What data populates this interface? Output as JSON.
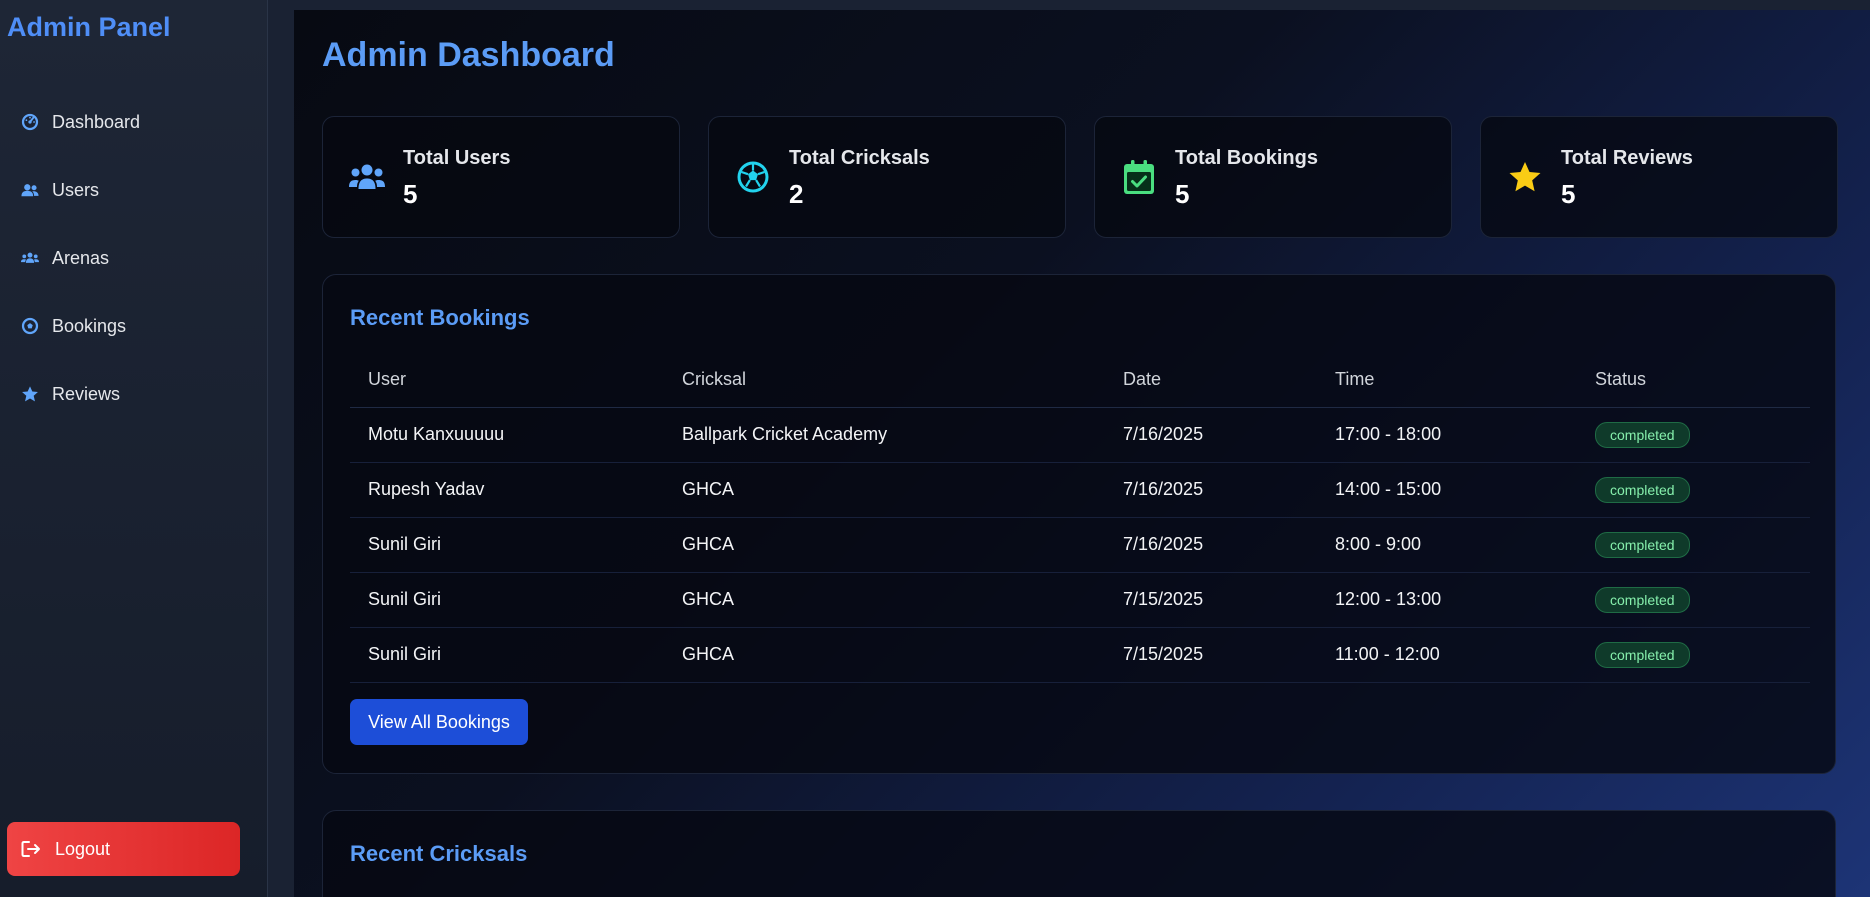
{
  "sidebar": {
    "brand": "Admin Panel",
    "items": [
      {
        "label": "Dashboard",
        "icon": "tachometer-icon"
      },
      {
        "label": "Users",
        "icon": "users-icon"
      },
      {
        "label": "Arenas",
        "icon": "users-group-icon"
      },
      {
        "label": "Bookings",
        "icon": "futbol-icon"
      },
      {
        "label": "Reviews",
        "icon": "star-icon"
      }
    ],
    "logout_label": "Logout"
  },
  "main": {
    "title": "Admin Dashboard",
    "stats": [
      {
        "label": "Total Users",
        "value": "5",
        "icon": "users-icon",
        "color": "#60a5fa"
      },
      {
        "label": "Total Cricksals",
        "value": "2",
        "icon": "futbol-icon",
        "color": "#22d3ee"
      },
      {
        "label": "Total Bookings",
        "value": "5",
        "icon": "calendar-check-icon",
        "color": "#4ade80"
      },
      {
        "label": "Total Reviews",
        "value": "5",
        "icon": "star-icon",
        "color": "#facc15"
      }
    ],
    "recent_bookings": {
      "title": "Recent Bookings",
      "columns": [
        "User",
        "Cricksal",
        "Date",
        "Time",
        "Status"
      ],
      "rows": [
        {
          "user": "Motu Kanxuuuuu",
          "cricksal": "Ballpark Cricket Academy",
          "date": "7/16/2025",
          "time": "17:00 - 18:00",
          "status": "completed"
        },
        {
          "user": "Rupesh Yadav",
          "cricksal": "GHCA",
          "date": "7/16/2025",
          "time": "14:00 - 15:00",
          "status": "completed"
        },
        {
          "user": "Sunil Giri",
          "cricksal": "GHCA",
          "date": "7/16/2025",
          "time": "8:00 - 9:00",
          "status": "completed"
        },
        {
          "user": "Sunil Giri",
          "cricksal": "GHCA",
          "date": "7/15/2025",
          "time": "12:00 - 13:00",
          "status": "completed"
        },
        {
          "user": "Sunil Giri",
          "cricksal": "GHCA",
          "date": "7/15/2025",
          "time": "11:00 - 12:00",
          "status": "completed"
        }
      ],
      "view_all_label": "View All Bookings"
    },
    "recent_cricksals": {
      "title": "Recent Cricksals"
    }
  },
  "colors": {
    "accent": "#5b9cf6",
    "primary_button": "#1d4ed8",
    "logout": "#ef4444",
    "status_completed": "#86efac"
  }
}
